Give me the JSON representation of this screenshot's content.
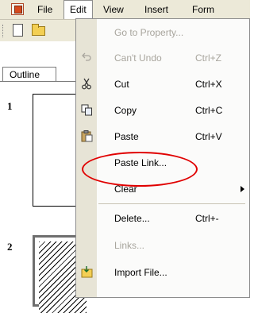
{
  "menubar": {
    "file": "File",
    "edit": "Edit",
    "view": "View",
    "insert": "Insert",
    "format": "Form"
  },
  "toolbar": {
    "new": "new-document",
    "open": "open-folder"
  },
  "panel": {
    "tab_outline": "Outline",
    "slide_1": "1",
    "slide_2": "2"
  },
  "menu": {
    "goto_property": "Go to Property...",
    "cant_undo": "Can't Undo",
    "cant_undo_shortcut": "Ctrl+Z",
    "cut": "Cut",
    "cut_shortcut": "Ctrl+X",
    "copy": "Copy",
    "copy_shortcut": "Ctrl+C",
    "paste": "Paste",
    "paste_shortcut": "Ctrl+V",
    "paste_link": "Paste Link...",
    "clear": "Clear",
    "delete": "Delete...",
    "delete_shortcut": "Ctrl+-",
    "links": "Links...",
    "import_file": "Import File..."
  },
  "colors": {
    "highlight_ring": "#e00000",
    "menu_bg": "#fbfbfa",
    "bar_bg": "#ece9d8"
  }
}
